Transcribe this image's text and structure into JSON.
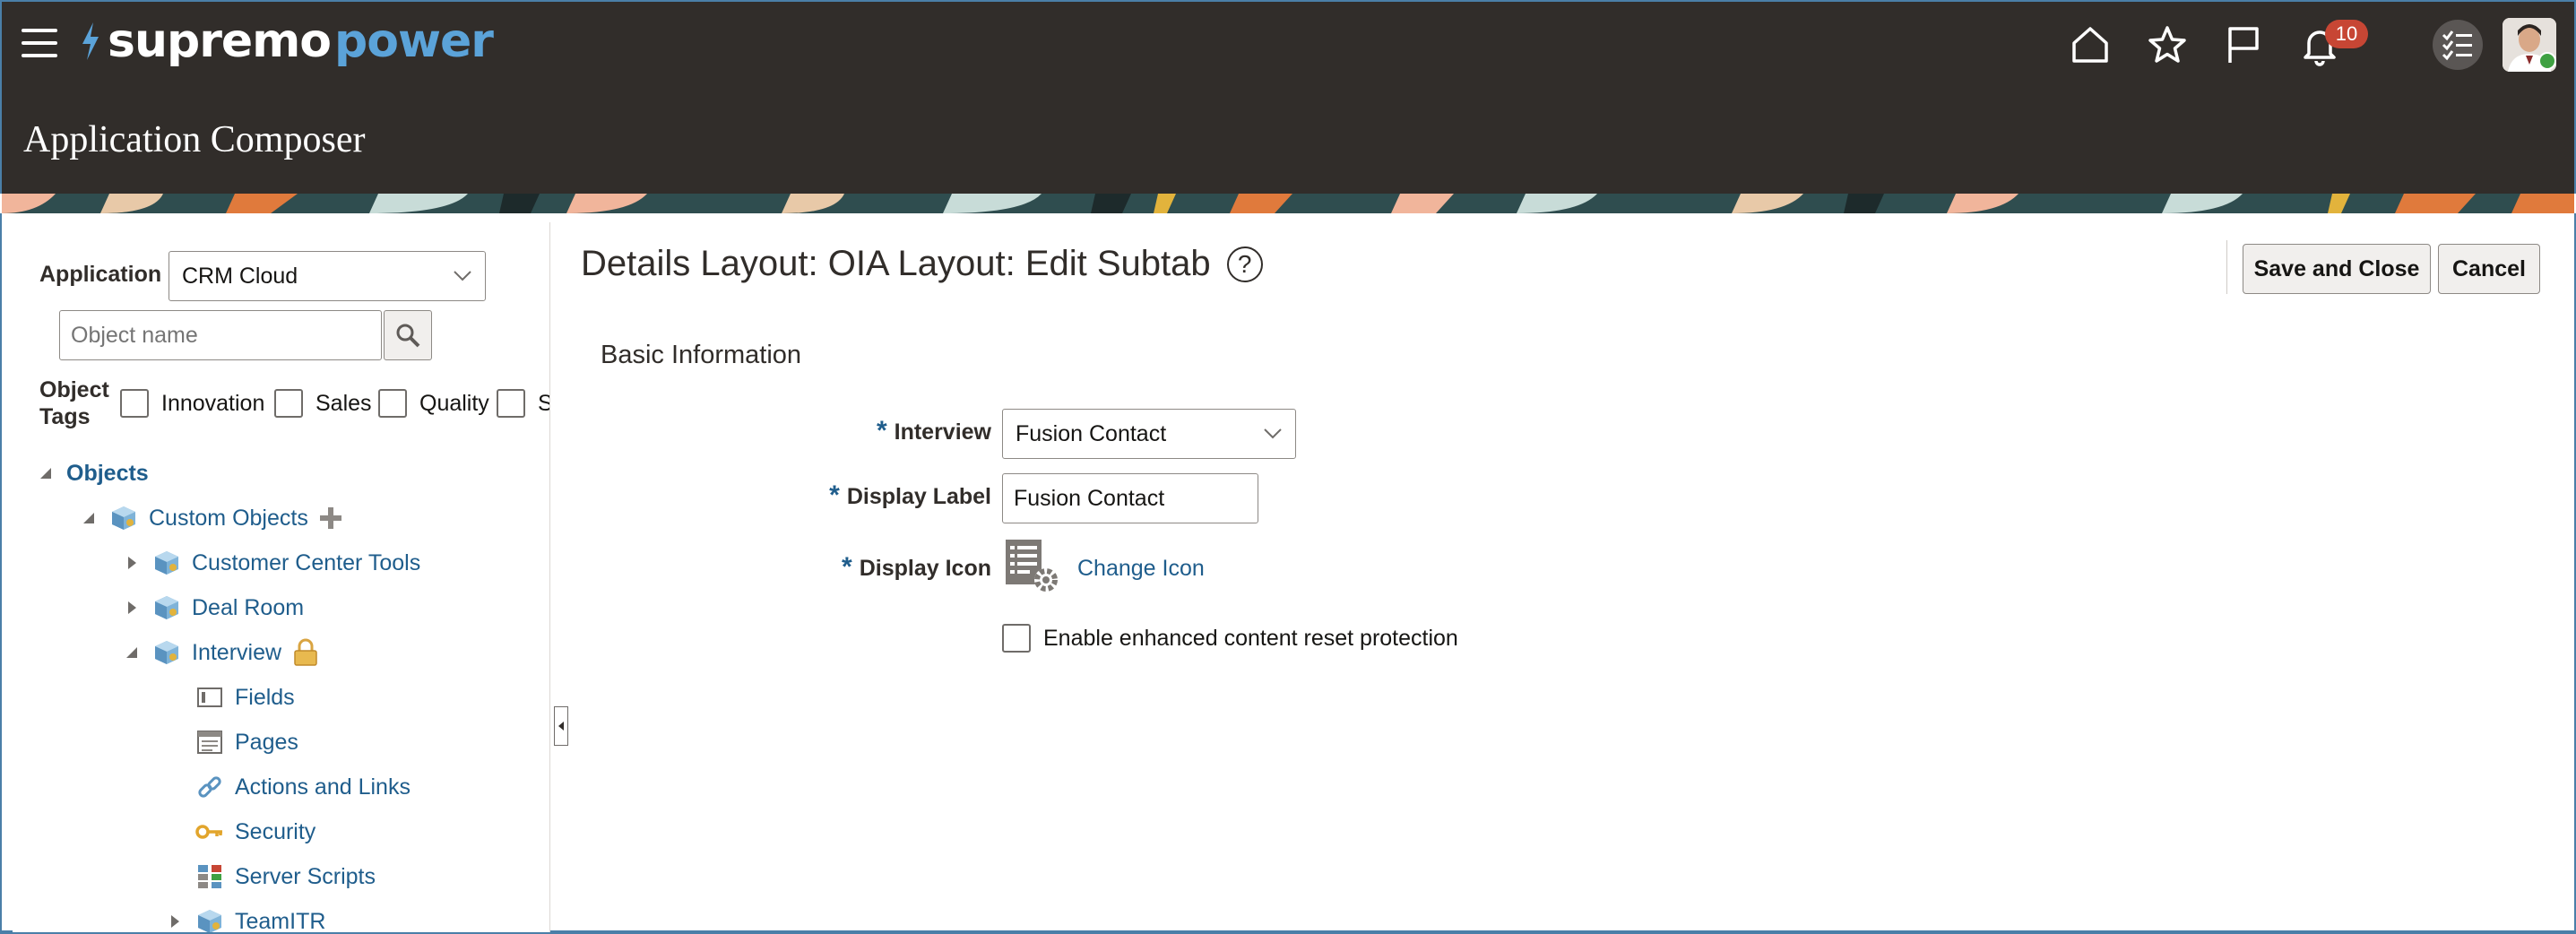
{
  "header": {
    "brand_part1": "supremo",
    "brand_part2": "power",
    "app_title": "Application Composer",
    "notification_count": "10",
    "icons": [
      "menu-icon",
      "home-icon",
      "star-icon",
      "flag-icon",
      "bell-icon",
      "tasks-icon",
      "avatar"
    ]
  },
  "sidebar": {
    "application_label": "Application",
    "application_value": "CRM Cloud",
    "search_placeholder": "Object name",
    "tags_label_line1": "Object",
    "tags_label_line2": "Tags",
    "tags": [
      "Innovation",
      "Sales",
      "Quality",
      "S"
    ],
    "tree": {
      "root": "Objects",
      "custom_objects": "Custom Objects",
      "items": [
        "Customer Center Tools",
        "Deal Room",
        "Interview"
      ],
      "interview_children": [
        "Fields",
        "Pages",
        "Actions and Links",
        "Security",
        "Server Scripts"
      ],
      "last_item": "TeamITR"
    }
  },
  "main": {
    "heading": "Details Layout: OIA Layout: Edit Subtab",
    "help_symbol": "?",
    "save_close": "Save and Close",
    "cancel": "Cancel",
    "section_title": "Basic Information",
    "required_marker": "*",
    "interview_label": "Interview",
    "interview_value": "Fusion Contact",
    "display_label_label": "Display Label",
    "display_label_value": "Fusion Contact",
    "display_icon_label": "Display Icon",
    "change_icon": "Change Icon",
    "enhanced_label": "Enable enhanced content reset protection",
    "enhanced_checked": false
  },
  "colors": {
    "header_bg": "#312d2a",
    "brand_blue": "#5ba3d9",
    "link": "#1f5d8c",
    "badge": "#c74634",
    "presence": "#3fa142"
  }
}
